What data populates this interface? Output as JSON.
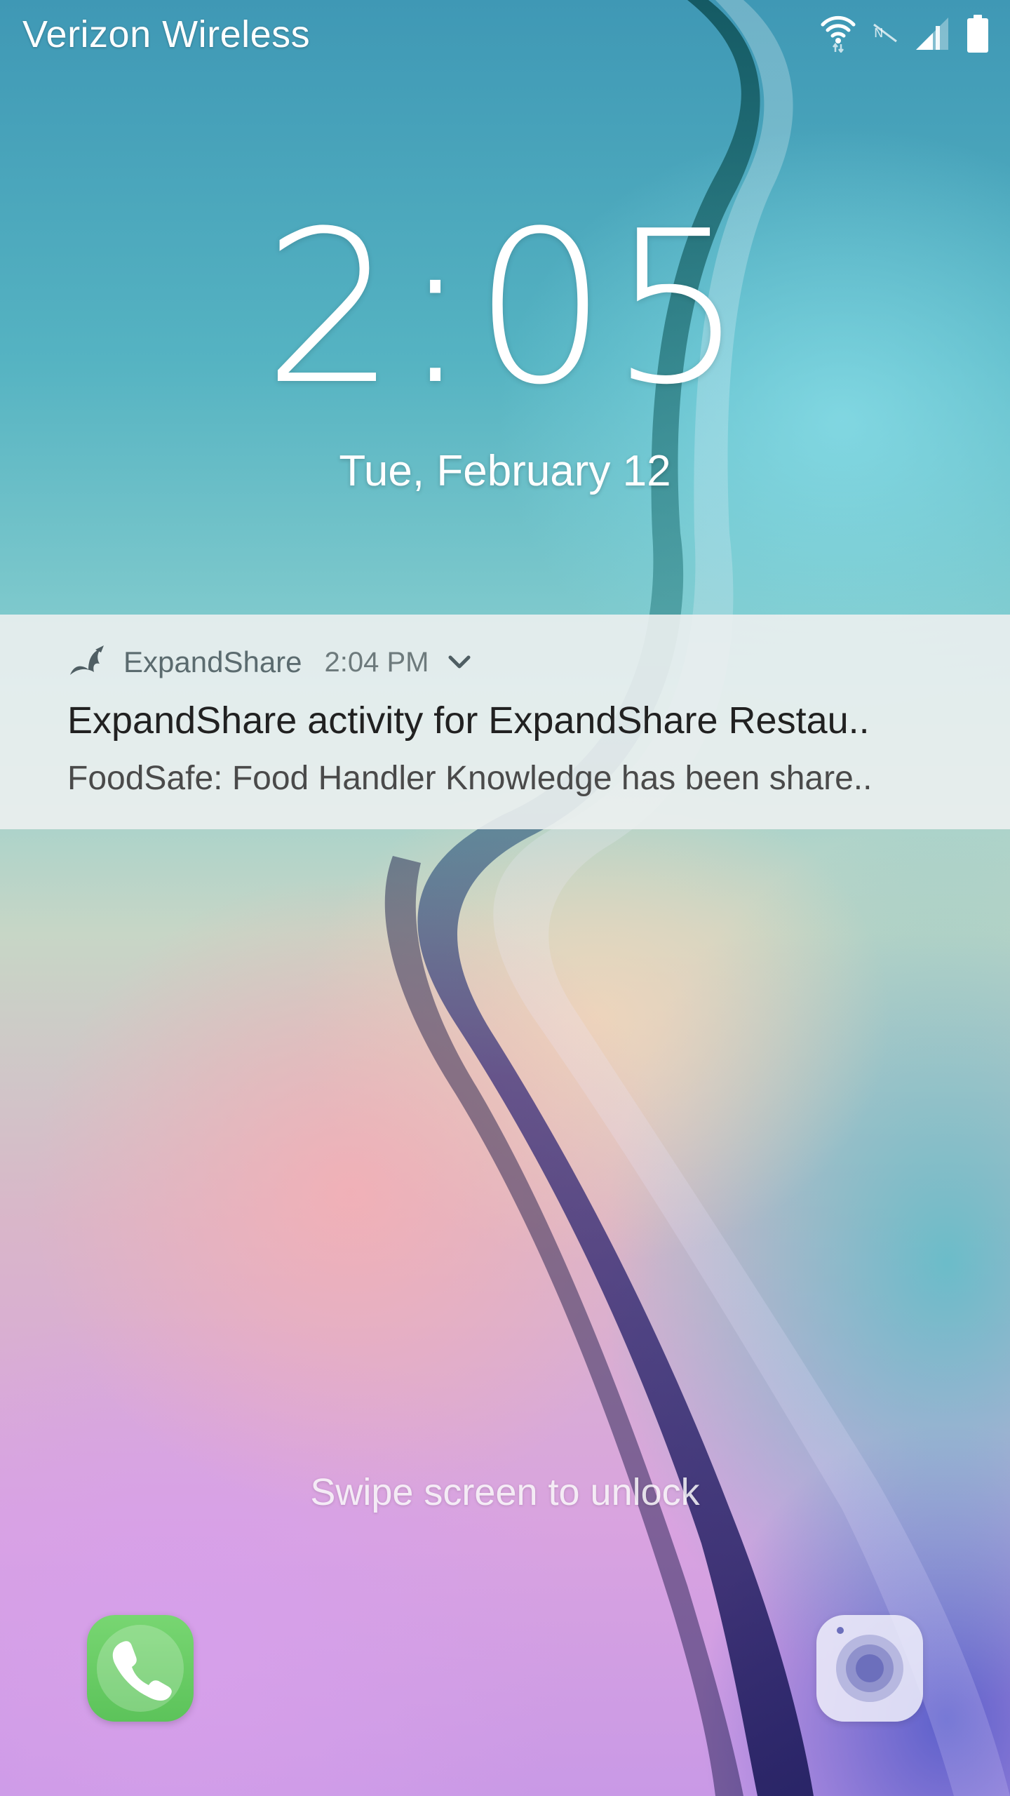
{
  "status_bar": {
    "carrier": "Verizon Wireless",
    "icons": [
      "wifi-icon",
      "nfc-off-icon",
      "cellular-signal-icon",
      "battery-icon"
    ]
  },
  "lock_screen": {
    "time": "2:05",
    "date": "Tue, February 12",
    "unlock_hint": "Swipe screen to unlock"
  },
  "notification": {
    "app_name": "ExpandShare",
    "time": "2:04 PM",
    "title": "ExpandShare activity for ExpandShare Restau..",
    "text": "FoodSafe: Food Handler Knowledge has been share.."
  },
  "shortcuts": {
    "left": "phone-icon",
    "right": "camera-icon"
  },
  "colors": {
    "notification_background": "#ECF0F0",
    "phone_shortcut": "#5CC35A",
    "camera_shortcut": "#EEEEFA"
  }
}
